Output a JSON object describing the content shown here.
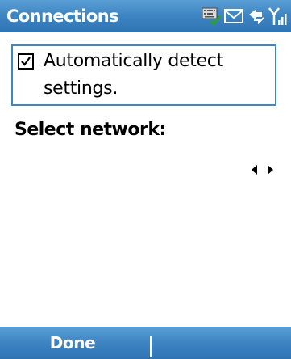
{
  "title_bar": {
    "title": "Connections",
    "icons": [
      "keyboard-check-icon",
      "mail-icon",
      "sync-icon",
      "signal-strength-icon"
    ]
  },
  "settings": {
    "auto_detect_label": "Automatically detect settings.",
    "auto_detect_checked": true,
    "select_network_label": "Select network:",
    "network_value": ""
  },
  "softkeys": {
    "left": "Done",
    "right": ""
  },
  "colors": {
    "accent": "#3f86c4",
    "bar_top": "#5a9fd4",
    "bar_bottom": "#2f73b3",
    "text": "#000000",
    "background": "#ffffff"
  }
}
